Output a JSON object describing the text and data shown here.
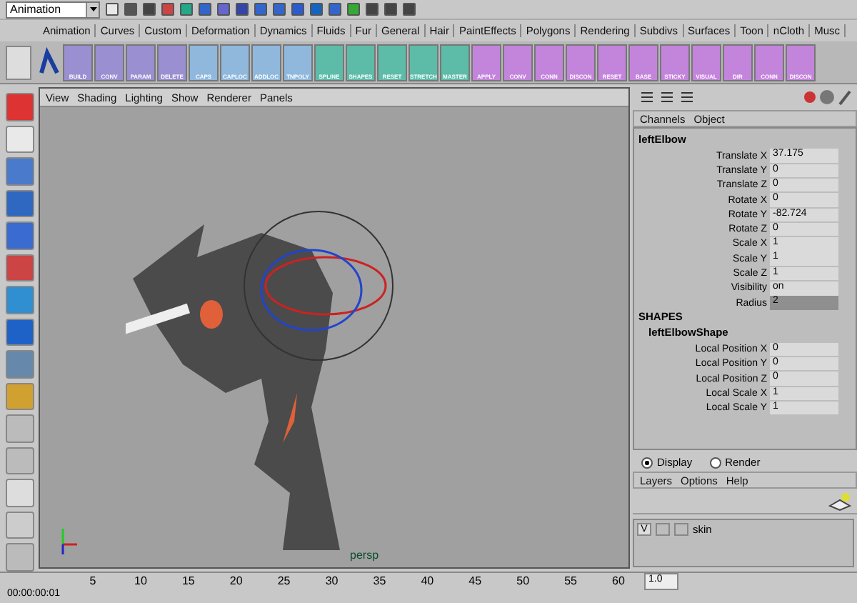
{
  "mode_menu": {
    "value": "Animation"
  },
  "shelf_tabs": [
    "Animation",
    "Curves",
    "Custom",
    "Deformation",
    "Dynamics",
    "Fluids",
    "Fur",
    "General",
    "Hair",
    "PaintEffects",
    "Polygons",
    "Rendering",
    "Subdivs",
    "Surfaces",
    "Toon",
    "nCloth",
    "Musc"
  ],
  "shelf_buttons": [
    {
      "label": "BUILD",
      "color": "#9a8fd0"
    },
    {
      "label": "CONV",
      "color": "#9a8fd0"
    },
    {
      "label": "PARAM",
      "color": "#9a8fd0"
    },
    {
      "label": "DELETE",
      "color": "#9a8fd0"
    },
    {
      "label": "CAPS",
      "color": "#8fb8dc"
    },
    {
      "label": "CAPLOC",
      "color": "#8fb8dc"
    },
    {
      "label": "ADDLOC",
      "color": "#8fb8dc"
    },
    {
      "label": "TNPOLY",
      "color": "#8fb8dc"
    },
    {
      "label": "SPLINE",
      "color": "#5cbca8"
    },
    {
      "label": "SHAPES",
      "color": "#5cbca8"
    },
    {
      "label": "RESET",
      "color": "#5cbca8"
    },
    {
      "label": "STRETCH",
      "color": "#5cbca8"
    },
    {
      "label": "MASTER",
      "color": "#5cbca8"
    },
    {
      "label": "APPLY",
      "color": "#c384dc"
    },
    {
      "label": "CONV",
      "color": "#c384dc"
    },
    {
      "label": "CONN",
      "color": "#c384dc"
    },
    {
      "label": "DISCON",
      "color": "#c384dc"
    },
    {
      "label": "RESET",
      "color": "#c384dc"
    },
    {
      "label": "BASE",
      "color": "#c384dc"
    },
    {
      "label": "STICKY",
      "color": "#c384dc"
    },
    {
      "label": "VISUAL",
      "color": "#c384dc"
    },
    {
      "label": "DIR",
      "color": "#c384dc"
    },
    {
      "label": "CONN",
      "color": "#c384dc"
    },
    {
      "label": "DISCON",
      "color": "#c384dc"
    }
  ],
  "viewport": {
    "menus": [
      "View",
      "Shading",
      "Lighting",
      "Show",
      "Renderer",
      "Panels"
    ],
    "camera_label": "persp"
  },
  "channel_box": {
    "menus": [
      "Channels",
      "Object"
    ],
    "node": "leftElbow",
    "channels": [
      {
        "name": "Translate X",
        "value": "37.175",
        "highlighted": false
      },
      {
        "name": "Translate Y",
        "value": "0",
        "highlighted": false
      },
      {
        "name": "Translate Z",
        "value": "0",
        "highlighted": false
      },
      {
        "name": "Rotate X",
        "value": "0",
        "highlighted": false
      },
      {
        "name": "Rotate Y",
        "value": "-82.724",
        "highlighted": false
      },
      {
        "name": "Rotate Z",
        "value": "0",
        "highlighted": false
      },
      {
        "name": "Scale X",
        "value": "1",
        "highlighted": false
      },
      {
        "name": "Scale Y",
        "value": "1",
        "highlighted": false
      },
      {
        "name": "Scale Z",
        "value": "1",
        "highlighted": false
      },
      {
        "name": "Visibility",
        "value": "on",
        "highlighted": false
      },
      {
        "name": "Radius",
        "value": "2",
        "highlighted": true
      }
    ],
    "shapes_header": "SHAPES",
    "shape_node": "leftElbowShape",
    "shape_channels": [
      {
        "name": "Local Position X",
        "value": "0"
      },
      {
        "name": "Local Position Y",
        "value": "0"
      },
      {
        "name": "Local Position Z",
        "value": "0"
      },
      {
        "name": "Local Scale X",
        "value": "1"
      },
      {
        "name": "Local Scale Y",
        "value": "1"
      }
    ]
  },
  "layer_editor": {
    "modes": [
      {
        "label": "Display",
        "selected": true
      },
      {
        "label": "Render",
        "selected": false
      }
    ],
    "menus": [
      "Layers",
      "Options",
      "Help"
    ],
    "layers": [
      {
        "visibility": "V",
        "name": "skin"
      }
    ]
  },
  "timeline": {
    "current_time": "00:00:00:01",
    "ticks": [
      "5",
      "10",
      "15",
      "20",
      "25",
      "30",
      "35",
      "40",
      "45",
      "50",
      "55",
      "60"
    ],
    "start_field": "1.0"
  }
}
